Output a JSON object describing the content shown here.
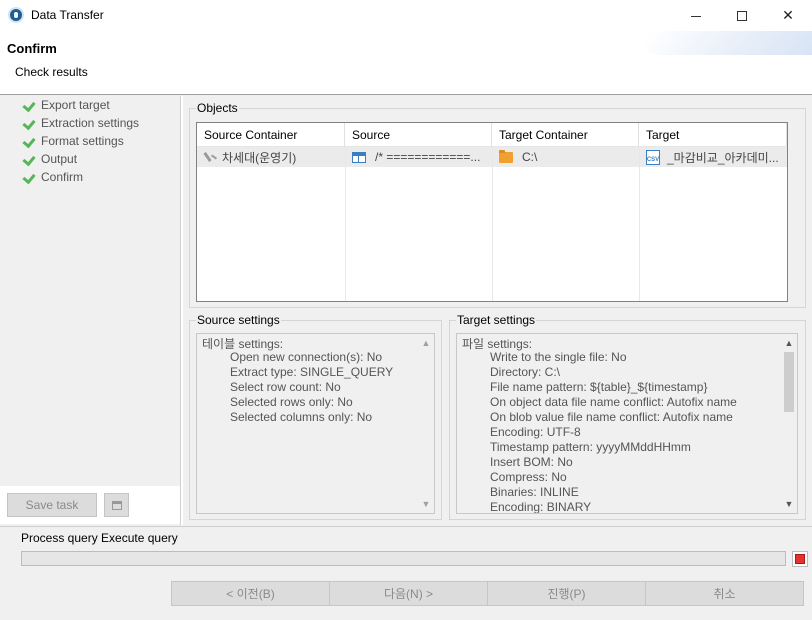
{
  "window": {
    "title": "Data Transfer",
    "icon": "dbeaver-icon"
  },
  "header": {
    "title": "Confirm",
    "subtitle": "Check results"
  },
  "steps": [
    {
      "label": "Export target",
      "status": "done"
    },
    {
      "label": "Extraction settings",
      "status": "done"
    },
    {
      "label": "Format settings",
      "status": "done"
    },
    {
      "label": "Output",
      "status": "done"
    },
    {
      "label": "Confirm",
      "status": "done"
    }
  ],
  "left_footer": {
    "save_task_label": "Save task",
    "task_icon": "printer-icon"
  },
  "objects": {
    "group_label": "Objects",
    "columns": [
      "Source Container",
      "Source",
      "Target Container",
      "Target"
    ],
    "rows": [
      [
        "차세대(운영기)",
        "/* ============...",
        "C:\\",
        "_마감비교_아카데미..."
      ]
    ]
  },
  "source_settings": {
    "group_label": "Source settings",
    "heading": "테이블 settings:",
    "lines": [
      "Open new connection(s): No",
      "Extract type: SINGLE_QUERY",
      "Select row count: No",
      "Selected rows only: No",
      "Selected columns only: No"
    ]
  },
  "target_settings": {
    "group_label": "Target settings",
    "heading": "파일 settings:",
    "lines": [
      "Write to the single file: No",
      "Directory: C:\\",
      "File name pattern: ${table}_${timestamp}",
      "On object data file name conflict: Autofix name",
      "On blob value file name conflict: Autofix name",
      "Encoding: UTF-8",
      "Timestamp pattern: yyyyMMddHHmm",
      "Insert BOM: No",
      "Compress: No",
      "Binaries: INLINE",
      "Encoding: BINARY"
    ]
  },
  "progress": {
    "label": "Process query Execute query",
    "fraction": 0
  },
  "nav": {
    "back": "< 이전(B)",
    "next": "다음(N) >",
    "proceed": "진행(P)",
    "cancel": "취소"
  },
  "colors": {
    "check": "#57b557",
    "stop": "#e63131",
    "folder": "#f0a030",
    "table": "#3a7fc1"
  }
}
